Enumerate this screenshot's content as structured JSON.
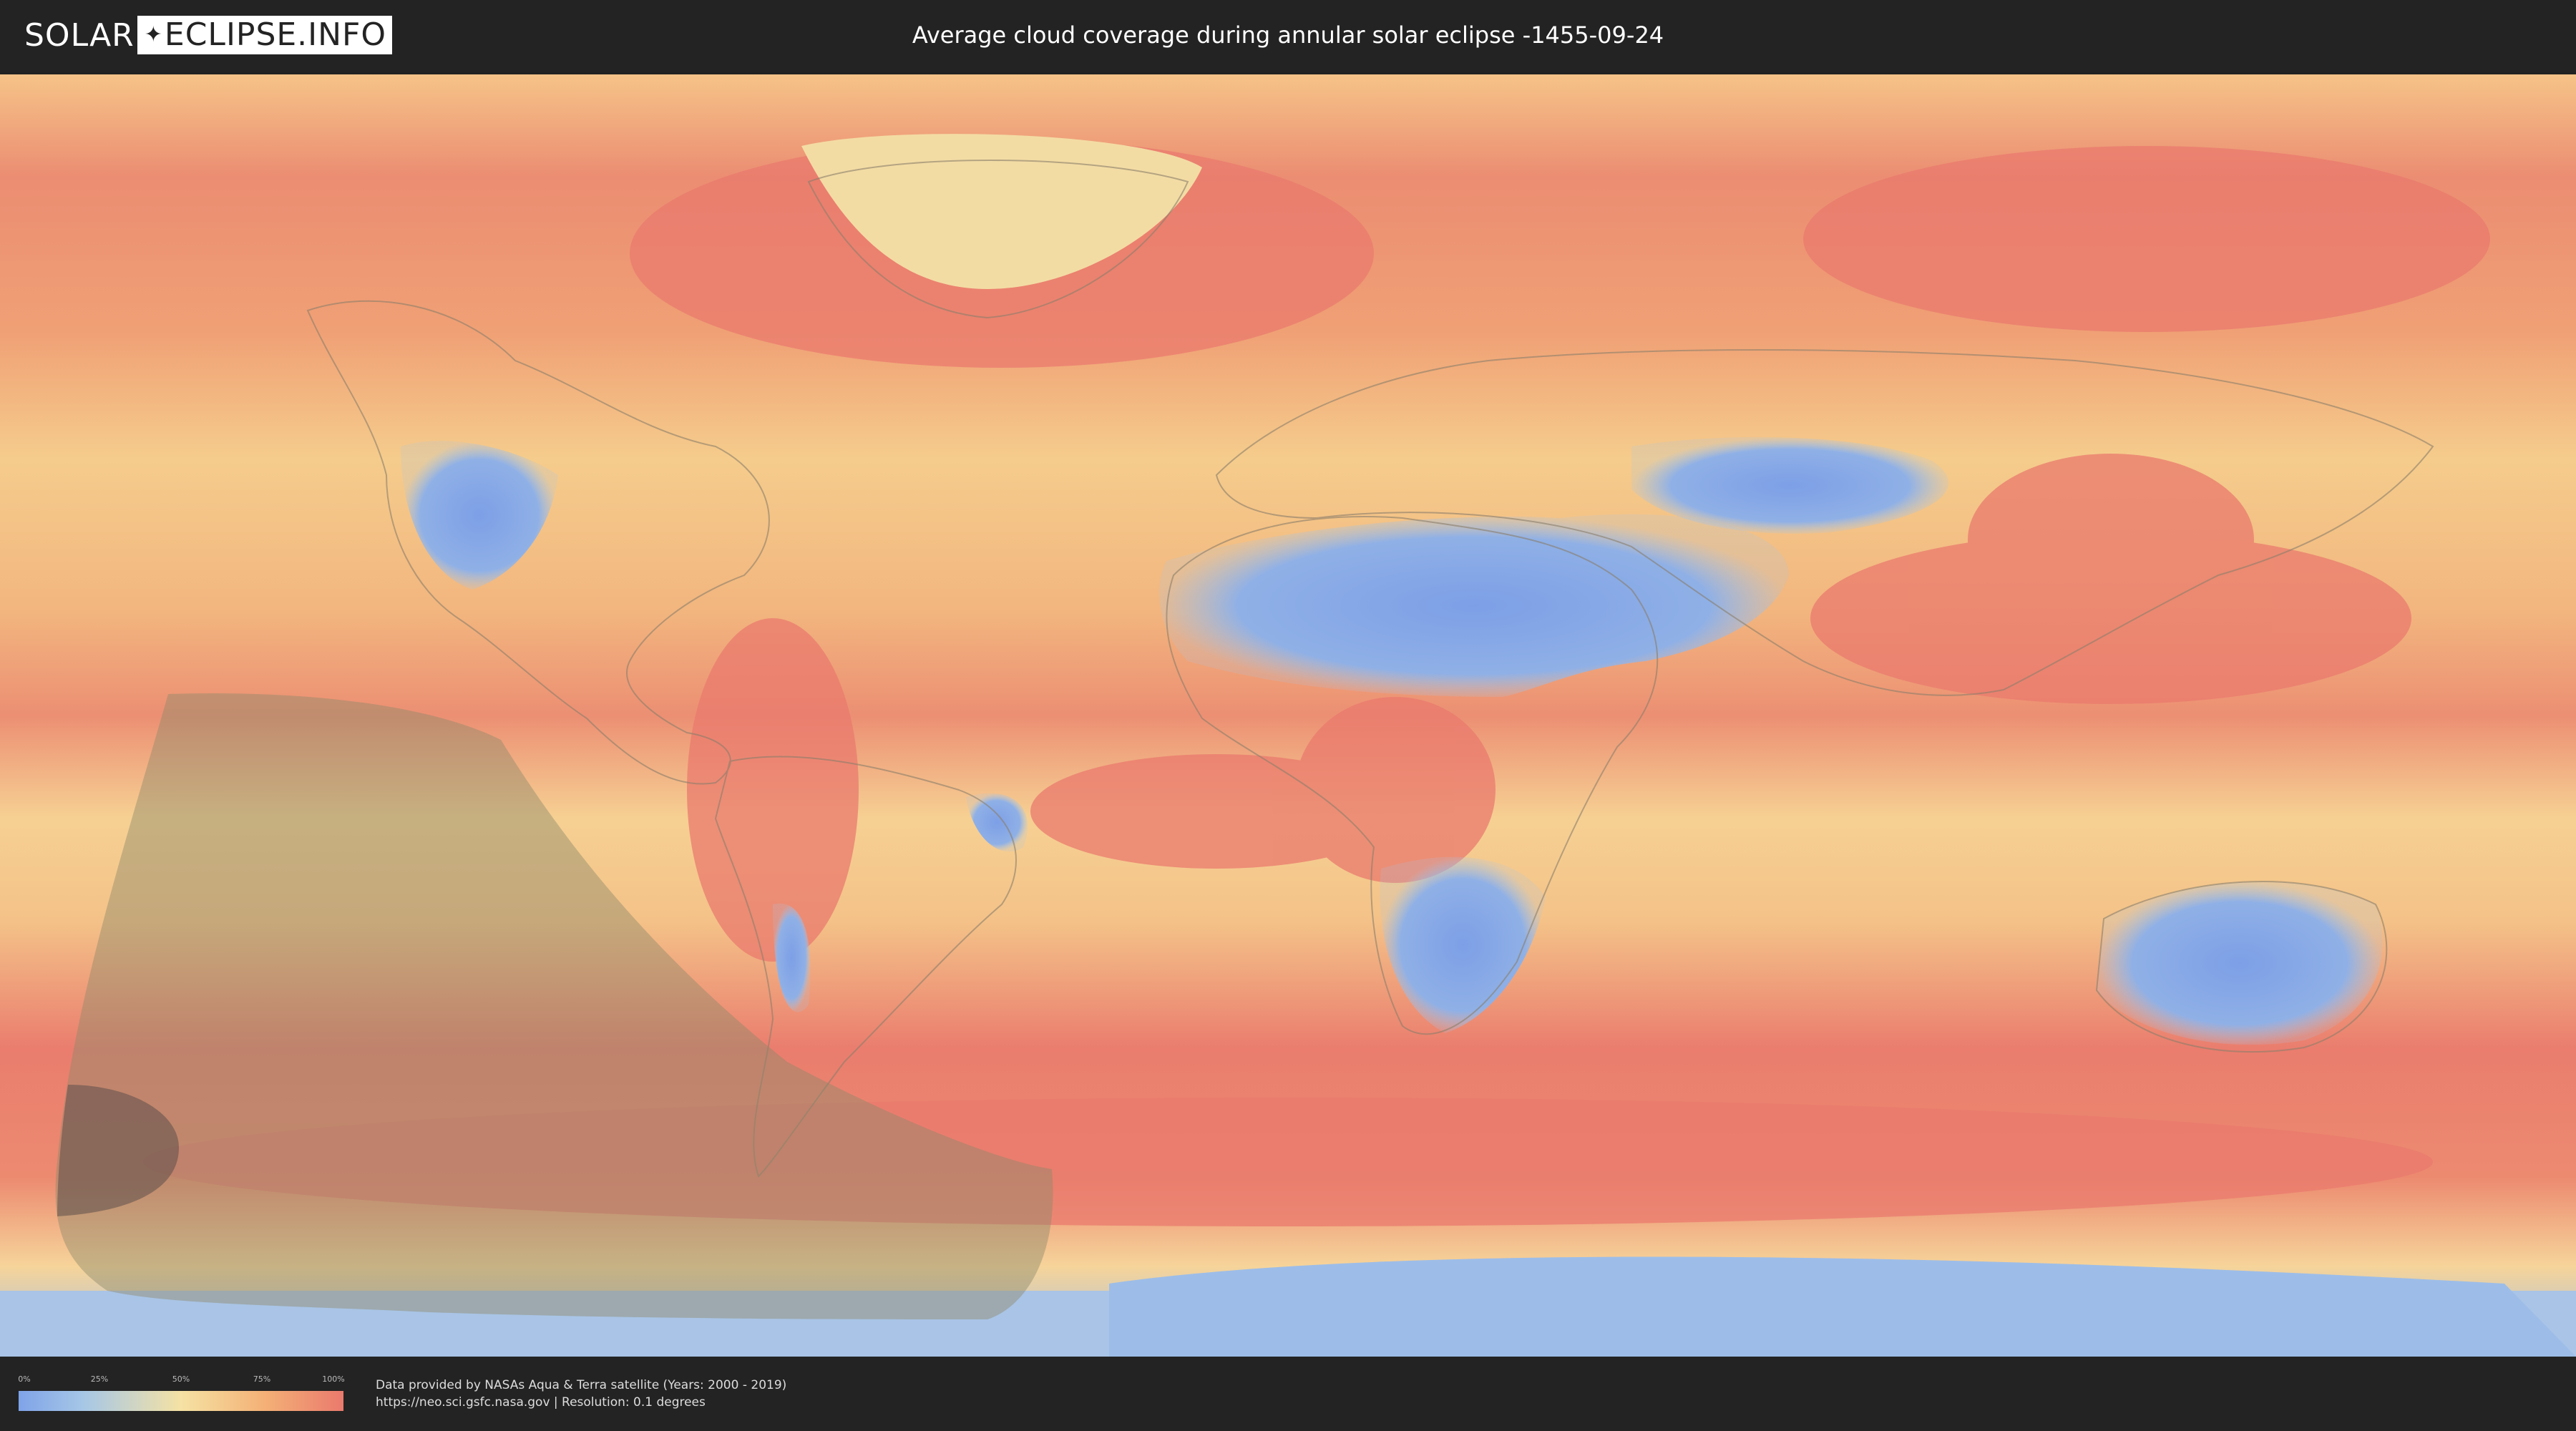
{
  "header": {
    "logo_left": "SOLAR",
    "logo_right": "ECLIPSE.INFO",
    "title": "Average cloud coverage during annular solar eclipse -1455-09-24"
  },
  "legend": {
    "ticks": [
      "0%",
      "25%",
      "50%",
      "75%",
      "100%"
    ],
    "colors": [
      "#7fa3e8",
      "#f5e2a4",
      "#ea7a6d"
    ]
  },
  "footer": {
    "credit_line1": "Data provided by NASAs Aqua & Terra satellite (Years: 2000 - 2019)",
    "credit_line2": "https://neo.sci.gsfc.nasa.gov | Resolution: 0.1 degrees"
  },
  "map": {
    "projection": "equirectangular",
    "eclipse_region_color": "#8f8a6a",
    "central_shadow_color": "#5d4f4a",
    "high_cloud_color": "#e9776b",
    "low_cloud_color": "#7fa3e8"
  }
}
